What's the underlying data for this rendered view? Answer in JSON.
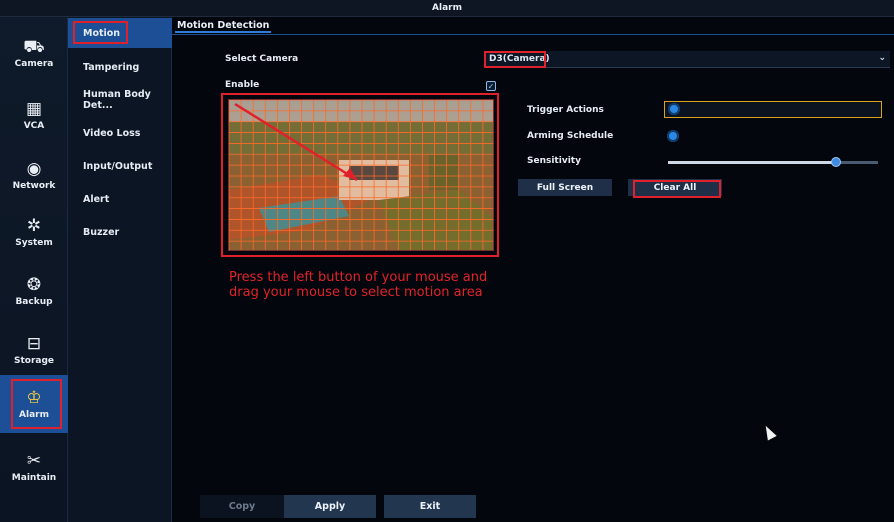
{
  "window": {
    "title": "Alarm"
  },
  "icon_sidebar": {
    "items": [
      {
        "label": "Camera",
        "icon": "camera-icon",
        "glyph": "⛟"
      },
      {
        "label": "VCA",
        "icon": "vca-icon",
        "glyph": "▦"
      },
      {
        "label": "Network",
        "icon": "network-icon",
        "glyph": "◉"
      },
      {
        "label": "System",
        "icon": "system-gear-icon",
        "glyph": "✲"
      },
      {
        "label": "Backup",
        "icon": "backup-icon",
        "glyph": "❂"
      },
      {
        "label": "Storage",
        "icon": "storage-icon",
        "glyph": "⊟"
      },
      {
        "label": "Alarm",
        "icon": "alarm-icon",
        "glyph": "♔",
        "active": true
      },
      {
        "label": "Maintain",
        "icon": "maintain-tools-icon",
        "glyph": "✂"
      }
    ]
  },
  "submenu": {
    "items": [
      {
        "label": "Motion",
        "active": true
      },
      {
        "label": "Tampering"
      },
      {
        "label": "Human Body Det..."
      },
      {
        "label": "Video Loss"
      },
      {
        "label": "Input/Output"
      },
      {
        "label": "Alert"
      },
      {
        "label": "Buzzer"
      }
    ]
  },
  "main": {
    "tab": "Motion Detection",
    "select_camera_label": "Select Camera",
    "select_camera_value": "D3(Camera)",
    "enable_label": "Enable",
    "enable_checked": true,
    "trigger_actions_label": "Trigger Actions",
    "arming_schedule_label": "Arming Schedule",
    "sensitivity_label": "Sensitivity",
    "sensitivity_value": 0.8,
    "full_screen_label": "Full Screen",
    "clear_all_label": "Clear All",
    "hint_line1": "Press the left button of your mouse and",
    "hint_line2": "drag your mouse to select motion area",
    "grid": {
      "columns": 22,
      "rows": 14
    }
  },
  "footer": {
    "copy_label": "Copy",
    "apply_label": "Apply",
    "exit_label": "Exit"
  },
  "colors": {
    "accent_blue": "#1d4f97",
    "highlight_red": "#e0202a",
    "grid_orange": "#ff6a2a",
    "trigger_border": "#d9a320"
  }
}
